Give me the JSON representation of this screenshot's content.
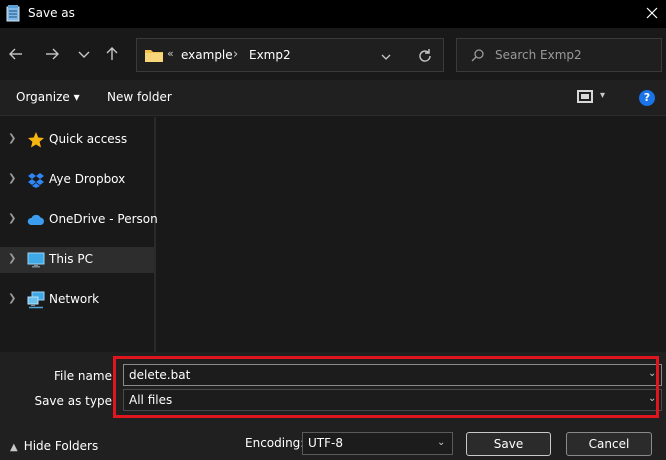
{
  "window": {
    "title": "Save as",
    "close_label": "✕"
  },
  "nav": {
    "back": "←",
    "forward": "→",
    "recent": "⌄",
    "up": "↑",
    "address": {
      "sep_root": "«",
      "crumbs": [
        "example",
        "Exmp2"
      ],
      "sep": "›"
    },
    "refresh": "⟳",
    "search_placeholder": "Search Exmp2"
  },
  "toolbar": {
    "organize": "Organize ▾",
    "new_folder": "New folder",
    "help": "?",
    "view_dd": "▾"
  },
  "sidebar": {
    "items": [
      {
        "label": "Quick access",
        "icon": "star-icon"
      },
      {
        "label": "Aye Dropbox",
        "icon": "dropbox-icon"
      },
      {
        "label": "OneDrive - Personal",
        "icon": "cloud-icon"
      },
      {
        "label": "This PC",
        "icon": "monitor-icon",
        "selected": true
      },
      {
        "label": "Network",
        "icon": "network-icon"
      }
    ]
  },
  "form": {
    "file_name_label": "File name:",
    "file_name_value": "delete.bat",
    "save_type_label": "Save as type:",
    "save_type_value": "All files",
    "encoding_label": "Encoding:",
    "encoding_value": "UTF-8"
  },
  "footer": {
    "hide_folders": "Hide Folders",
    "save": "Save",
    "cancel": "Cancel"
  },
  "colors": {
    "highlight": "#e0161e",
    "accent": "#1a73e8",
    "folder": "#f2c14e"
  }
}
